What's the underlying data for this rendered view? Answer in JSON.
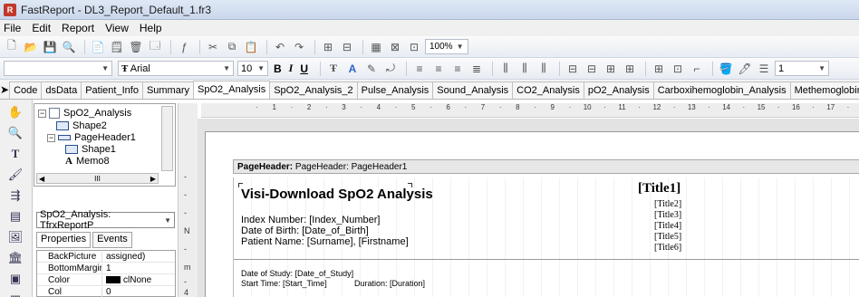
{
  "window": {
    "title": "FastReport - DL3_Report_Default_1.fr3",
    "app_icon_letter": "R"
  },
  "menu": [
    "File",
    "Edit",
    "Report",
    "View",
    "Help"
  ],
  "toolbar": {
    "zoom": "100%"
  },
  "format_bar": {
    "style_value": "",
    "font_name": "Arial",
    "font_size": "10",
    "bold": "B",
    "italic": "I",
    "underline": "U",
    "frame_width": "1"
  },
  "tabs": [
    "Code",
    "dsData",
    "Patient_Info",
    "Summary",
    "SpO2_Analysis",
    "SpO2_Analysis_2",
    "Pulse_Analysis",
    "Sound_Analysis",
    "CO2_Analysis",
    "pO2_Analysis",
    "Carboxihemoglobin_Analysis",
    "Methemoglobin_Anal"
  ],
  "active_tab": "SpO2_Analysis",
  "tree": {
    "items": [
      "SpO2_Analysis",
      "Shape2",
      "PageHeader1",
      "Shape1",
      "Memo8"
    ],
    "hscroll_label": "III"
  },
  "object_selector": "SpO2_Analysis: TfrxReportP",
  "inspector_tabs": [
    "Properties",
    "Events"
  ],
  "properties": [
    {
      "name": "BackPicture",
      "value": "assigned)"
    },
    {
      "name": "BottomMargir",
      "value": "1"
    },
    {
      "name": "Color",
      "value": "clNone"
    },
    {
      "name": "Col",
      "value": "0"
    }
  ],
  "ruler_numbers": [
    "1",
    "2",
    "3",
    "4",
    "5",
    "6",
    "7",
    "8",
    "9",
    "10",
    "11",
    "12",
    "13",
    "14",
    "15",
    "16",
    "17",
    "18",
    "19"
  ],
  "vruler_numbers": [
    "-",
    "-",
    "-",
    "N",
    "-",
    "m",
    "-",
    "4"
  ],
  "band_header": "PageHeader: PageHeader1",
  "report": {
    "title": "Visi-Download SpO2 Analysis",
    "title1": "[Title1]",
    "titles": [
      "[Title2]",
      "[Title3]",
      "[Title4]",
      "[Title5]",
      "[Title6]"
    ],
    "index": "Index Number: [Index_Number]",
    "dob": "Date of Birth:   [Date_of_Birth]",
    "patient": "Patient Name:  [Surname], [Firstname]",
    "study_date": "Date of Study: [Date_of_Study]",
    "start_time": "Start Time:    [Start_Time]",
    "duration": "Duration: [Duration]"
  }
}
